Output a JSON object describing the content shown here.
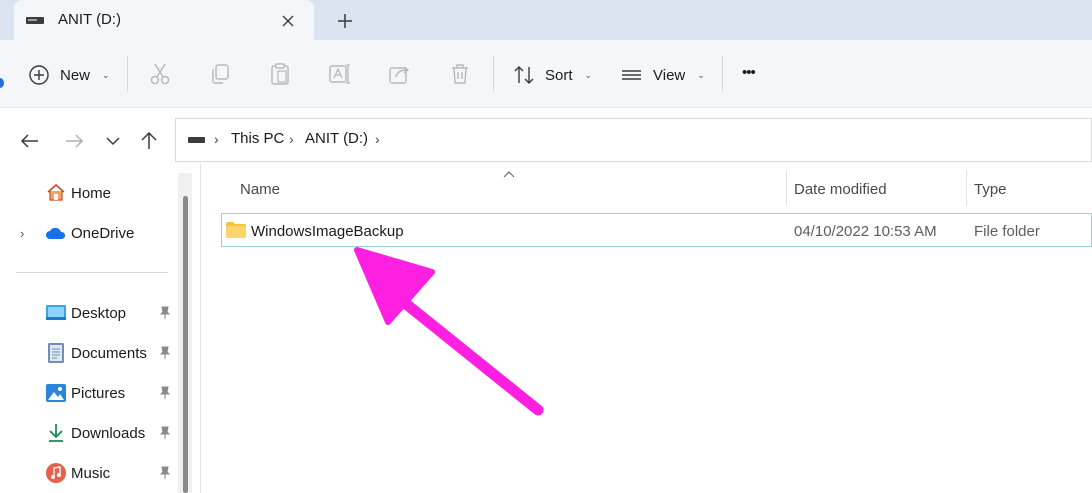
{
  "window": {
    "tab_title": "ANIT (D:)",
    "new_tab_symbol": "+",
    "close_symbol": "✕"
  },
  "commandbar": {
    "new_label": "New",
    "sort_label": "Sort",
    "view_label": "View",
    "more_label": "•••",
    "icons": [
      "new-plus-icon",
      "cut-icon",
      "copy-icon",
      "paste-icon",
      "rename-icon",
      "share-icon",
      "delete-icon",
      "sort-icon",
      "view-icon",
      "more-icon"
    ]
  },
  "address": {
    "crumbs": [
      "This PC",
      "ANIT (D:)"
    ]
  },
  "sidebar": {
    "items": [
      {
        "label": "Home",
        "icon": "home-icon"
      },
      {
        "label": "OneDrive",
        "icon": "onedrive-icon"
      },
      {
        "label": "Desktop",
        "icon": "desktop-icon",
        "pinned": true
      },
      {
        "label": "Documents",
        "icon": "documents-icon",
        "pinned": true
      },
      {
        "label": "Pictures",
        "icon": "pictures-icon",
        "pinned": true
      },
      {
        "label": "Downloads",
        "icon": "downloads-icon",
        "pinned": true
      },
      {
        "label": "Music",
        "icon": "music-icon",
        "pinned": true
      }
    ]
  },
  "filelist": {
    "columns": [
      "Name",
      "Date modified",
      "Type"
    ],
    "rows": [
      {
        "name": "WindowsImageBackup",
        "date": "04/10/2022 10:53 AM",
        "type": "File folder"
      }
    ]
  },
  "colors": {
    "accent": "#1e6fd9",
    "annotation_arrow": "#ff1fe0",
    "folder": "#f5c242",
    "selection_border": "#9ccfd8"
  }
}
